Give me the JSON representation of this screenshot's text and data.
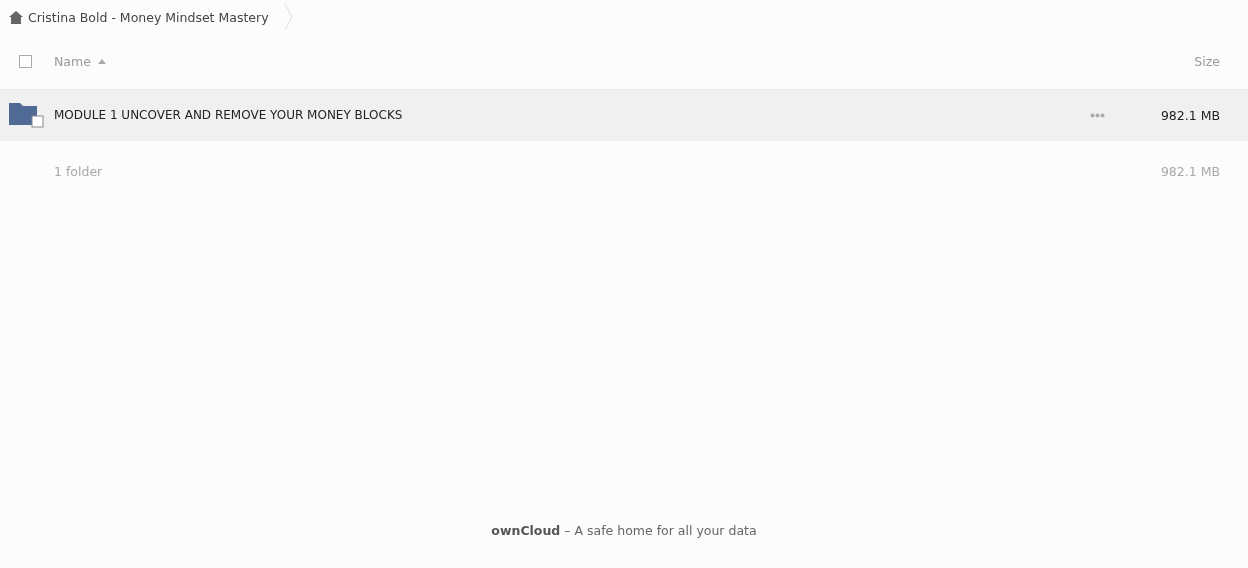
{
  "breadcrumb": {
    "label": "Cristina Bold - Money Mindset Mastery"
  },
  "table": {
    "select_all": {
      "checked": false
    },
    "columns": [
      {
        "label": "Name",
        "sorted_ascending": true
      },
      {
        "label": "Size"
      }
    ],
    "rows": [
      {
        "kind": "folder",
        "name": "MODULE 1 UNCOVER AND REMOVE YOUR MONEY BLOCKS",
        "size": "982.1 MB",
        "highlighted": true
      }
    ],
    "summary": {
      "count": "1 folder",
      "size": "982.1 MB"
    }
  },
  "footer": "**ownCloud** – A safe home for all your data"
}
